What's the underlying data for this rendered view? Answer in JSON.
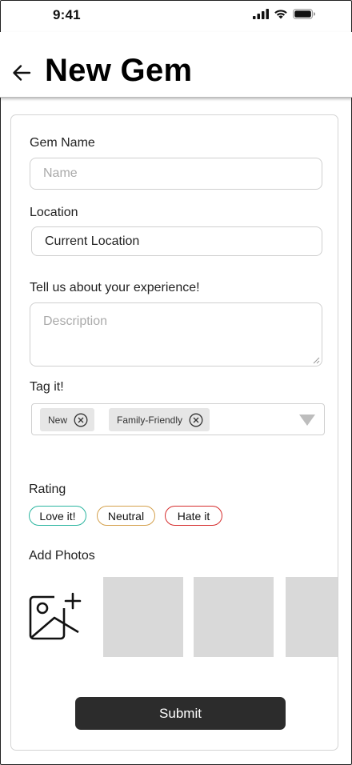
{
  "status_bar": {
    "time": "9:41"
  },
  "header": {
    "title": "New Gem"
  },
  "form": {
    "name_label": "Gem Name",
    "name_placeholder": "Name",
    "name_value": "",
    "location_label": "Location",
    "location_value": "Current Location",
    "experience_label": "Tell us about your experience!",
    "description_placeholder": "Description",
    "tags_label": "Tag it!",
    "tags": [
      "New",
      "Family-Friendly"
    ],
    "rating_label": "Rating",
    "ratings": [
      {
        "label": "Love it!",
        "color": "#2bb5a0"
      },
      {
        "label": "Neutral",
        "color": "#d4a04c"
      },
      {
        "label": "Hate it",
        "color": "#d62d2d"
      }
    ],
    "photos_label": "Add Photos",
    "photo_slot_color": "#d9d9d9",
    "submit_label": "Submit"
  },
  "icons": [
    "back-arrow-icon",
    "signal-icon",
    "wifi-icon",
    "battery-icon",
    "remove-tag-icon",
    "dropdown-caret-icon",
    "add-photo-icon"
  ]
}
